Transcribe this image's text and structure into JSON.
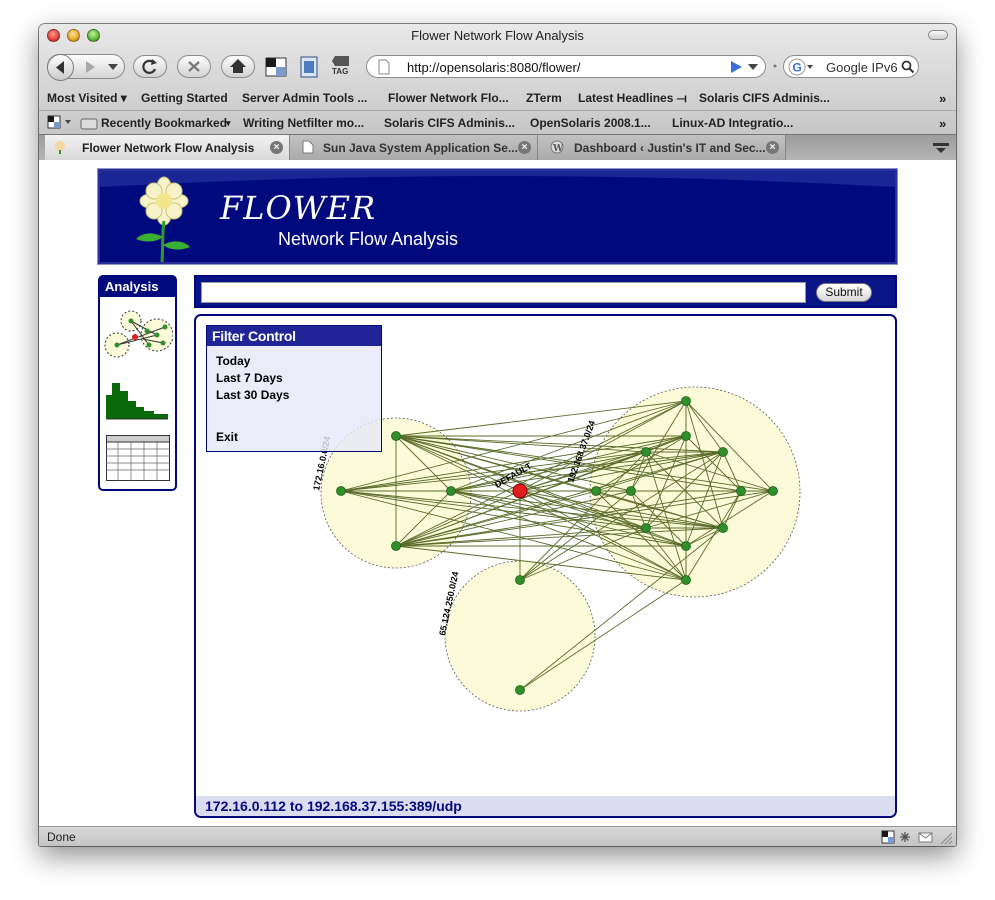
{
  "window": {
    "title": "Flower Network Flow Analysis"
  },
  "toolbar": {
    "url": "http://opensolaris:8080/flower/",
    "search_engine": "Google IPv6",
    "tag_label": "TAG"
  },
  "bookmarks": [
    {
      "label": "Most Visited ▾"
    },
    {
      "label": "Getting Started"
    },
    {
      "label": "Server Admin Tools ..."
    },
    {
      "label": "Flower Network Flo..."
    },
    {
      "label": "ZTerm"
    },
    {
      "label": "Latest Headlines ⟞"
    },
    {
      "label": "Solaris CIFS Adminis..."
    }
  ],
  "bookmarks2": [
    {
      "label": "Recently Bookmarked"
    },
    {
      "label": "Writing Netfilter mo..."
    },
    {
      "label": "Solaris CIFS Adminis..."
    },
    {
      "label": "OpenSolaris 2008.1..."
    },
    {
      "label": "Linux-AD Integratio..."
    }
  ],
  "tabs": [
    {
      "label": "Flower Network Flow Analysis",
      "active": true
    },
    {
      "label": "Sun Java System Application Se...",
      "active": false
    },
    {
      "label": "Dashboard ‹ Justin's IT and Sec...",
      "active": false
    }
  ],
  "status_bar": {
    "text": "Done"
  },
  "page": {
    "banner_title": "FLOWER",
    "banner_subtitle": "Network Flow Analysis",
    "side_heading": "Analysis",
    "submit_label": "Submit",
    "query_value": "",
    "filter": {
      "heading": "Filter Control",
      "items": [
        "Today",
        "Last 7 Days",
        "Last 30 Days"
      ],
      "exit": "Exit"
    },
    "graph": {
      "subnets": [
        {
          "label": "172.16.0.0/24"
        },
        {
          "label": "192.168.37.0/24"
        },
        {
          "label": "65.124.250.0/24"
        }
      ],
      "default_label": "DEFAULT"
    },
    "flow_status": "172.16.0.112 to 192.168.37.155:389/udp"
  },
  "colors": {
    "navy": "#000a7d",
    "node_green": "#2f8f2a",
    "edge_olive": "#5b6b2a",
    "cluster_fill": "#fbfbd9",
    "default_node": "#e11d1d"
  }
}
